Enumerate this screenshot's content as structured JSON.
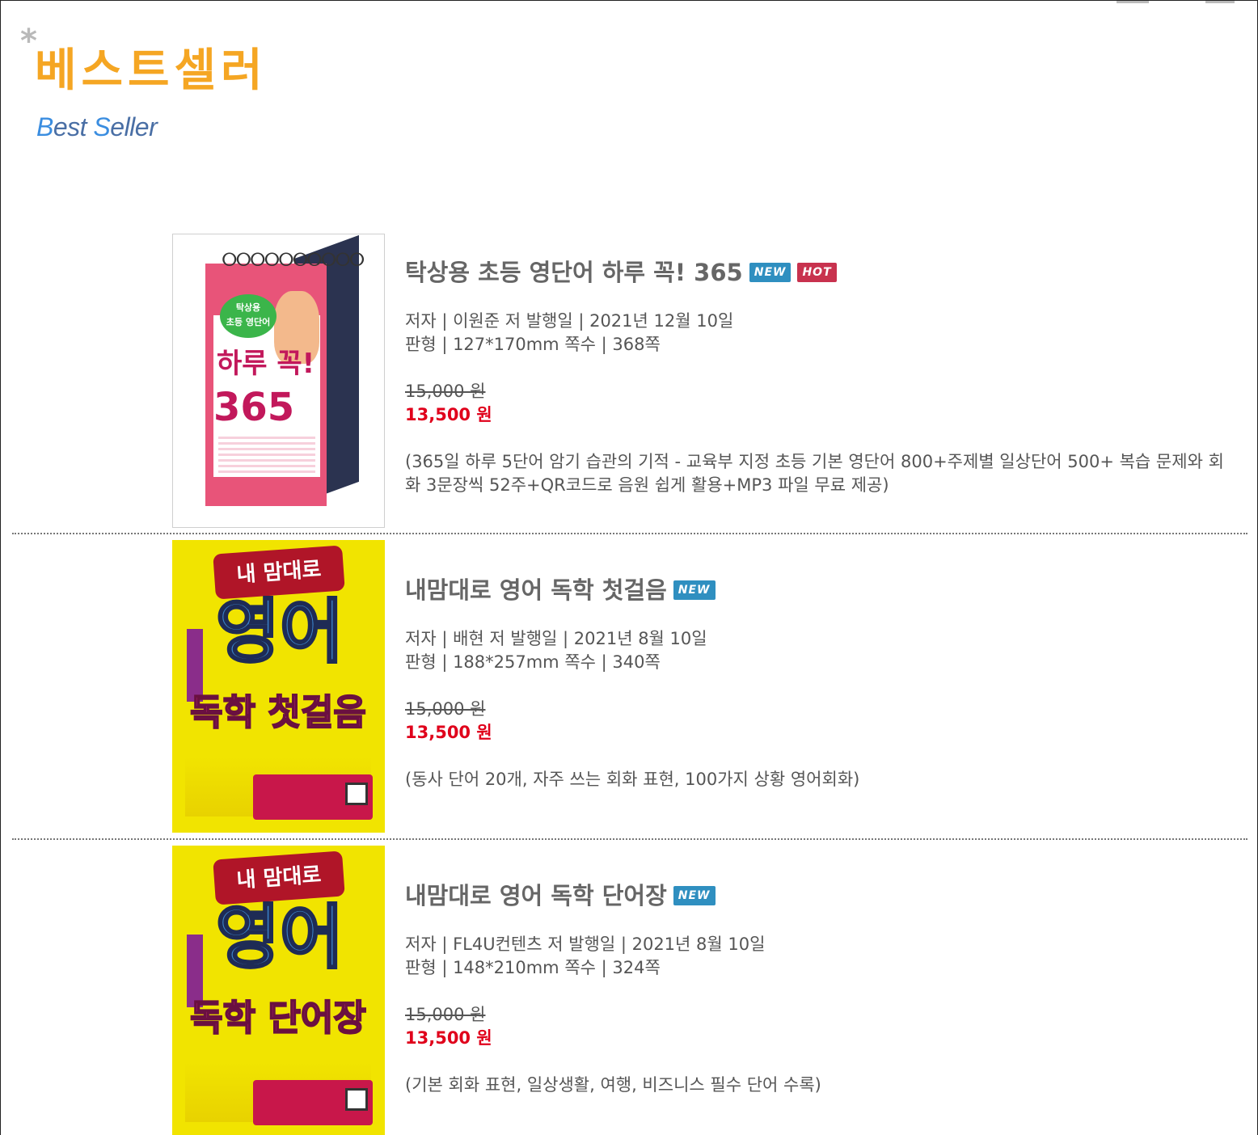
{
  "header": {
    "asterisk": "*",
    "title_ko": "베스트셀러",
    "title_en_b": "B",
    "title_en_1": "est ",
    "title_en_s": "S",
    "title_en_2": "eller"
  },
  "books": [
    {
      "title": "탁상용 초등 영단어 하루 꼭! 365",
      "badges": [
        "NEW",
        "HOT"
      ],
      "meta_line1": "저자 | 이원준 저  발행일 | 2021년 12월 10일",
      "meta_line2": "판형 | 127*170mm  쪽수 | 368쪽",
      "price_original": "15,000 원",
      "price_sale": "13,500 원",
      "description": "(365일 하루 5단어 암기 습관의 기적 - 교육부 지정 초등 기본 영단어 800+주제별 일상단어 500+ 복습 문제와 회화 3문장씩 52주+QR코드로 음원 쉽게 활용+MP3 파일 무료 제공)",
      "cover": {
        "bubble": "탁상용\n초등 영단어",
        "text1": "하루 꼭!",
        "text2": "365"
      }
    },
    {
      "title": "내맘대로 영어 독학 첫걸음",
      "badges": [
        "NEW"
      ],
      "meta_line1": "저자 | 배현 저  발행일 | 2021년 8월 10일",
      "meta_line2": "판형 | 188*257mm  쪽수 | 340쪽",
      "price_original": "15,000 원",
      "price_sale": "13,500 원",
      "description": "(동사 단어 20개, 자주 쓰는 회화 표현, 100가지 상황 영어회화)",
      "cover": {
        "banner": "내 맘대로",
        "big": "영어",
        "sub": "독학 첫걸음"
      }
    },
    {
      "title": "내맘대로 영어 독학 단어장",
      "badges": [
        "NEW"
      ],
      "meta_line1": "저자 | FL4U컨텐츠 저  발행일 | 2021년 8월 10일",
      "meta_line2": "판형 | 148*210mm   쪽수 | 324쪽",
      "price_original": "15,000 원",
      "price_sale": "13,500 원",
      "description": "(기본 회화 표현, 일상생활, 여행, 비즈니스 필수 단어 수록)",
      "cover": {
        "banner": "내 맘대로",
        "big": "영어",
        "sub": "독학 단어장"
      }
    }
  ]
}
